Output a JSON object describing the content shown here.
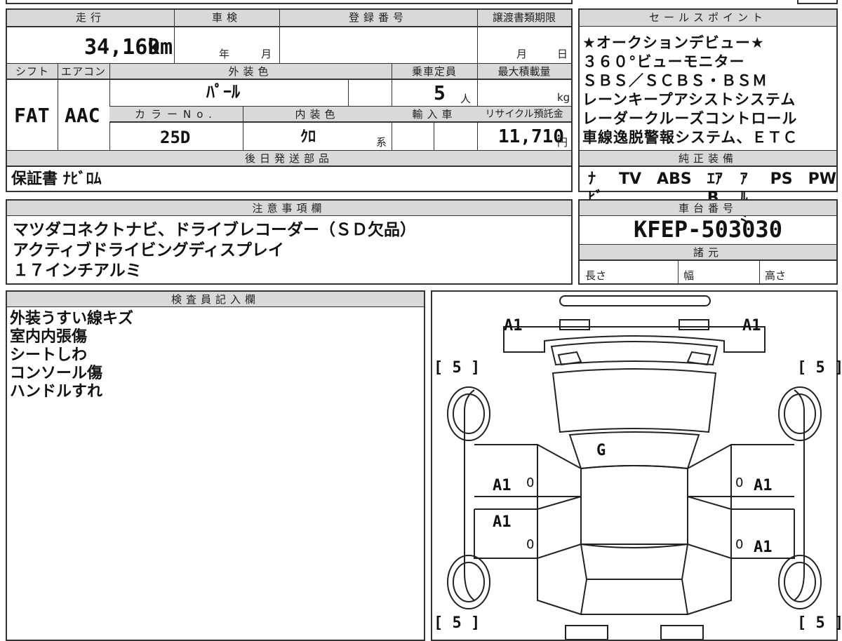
{
  "vehicle": {
    "mileage_label": "走行",
    "mileage_value": "34,169",
    "mileage_unit": "km",
    "inspection_label": "車検",
    "inspection_year_unit": "年",
    "inspection_month_unit": "月",
    "registration_label": "登録番号",
    "transfer_label": "譲渡書類期限",
    "transfer_month_unit": "月",
    "transfer_day_unit": "日",
    "shift_label": "シフト",
    "shift_value": "FAT",
    "aircon_label": "エアコン",
    "aircon_value": "AAC",
    "exterior_label": "外装色",
    "exterior_value": "ﾊﾟｰﾙ",
    "capacity_label": "乗車定員",
    "capacity_value": "5",
    "capacity_unit": "人",
    "max_load_label": "最大積載量",
    "max_load_unit": "kg",
    "color_no_label": "カラーNo.",
    "color_no_value": "25D",
    "interior_label": "内装色",
    "interior_value": "ｸﾛ",
    "interior_unit": "系",
    "import_label": "輸入車",
    "recycle_label": "リサイクル預託金",
    "recycle_value": "11,710",
    "recycle_unit": "円"
  },
  "later_parts": {
    "label": "後日発送部品",
    "value": "保証書 ﾅﾋﾞﾛﾑ"
  },
  "sales_points": {
    "label": "セールスポイント",
    "items": [
      "★オークションデビュー★",
      "３６０°ビューモニター",
      "ＳＢＳ／ＳＣＢＳ・ＢＳＭ",
      "レーンキープアシストシステム",
      "レーダークルーズコントロール",
      "車線逸脱警報システム、ＥＴＣ"
    ]
  },
  "equipment": {
    "label": "純正装備",
    "items": [
      "ﾅﾋﾞ",
      "TV",
      "ABS",
      "ｴｱB",
      "ｱﾙﾐ",
      "PS",
      "PW"
    ]
  },
  "notes": {
    "label": "注意事項欄",
    "lines": [
      "マツダコネクトナビ、ドライブレコーダー（ＳＤ欠品）",
      "アクティブドライビングディスプレイ",
      "１７インチアルミ"
    ]
  },
  "chassis": {
    "label": "車台番号",
    "value": "KFEP-503030"
  },
  "specs": {
    "label": "諸元",
    "length_label": "長さ",
    "width_label": "幅",
    "height_label": "高さ"
  },
  "inspector": {
    "label": "検査員記入欄",
    "lines": [
      "外装うすい線キズ",
      "室内内張傷",
      "シートしわ",
      "コンソール傷",
      "ハンドルすれ"
    ]
  },
  "diagram": {
    "tire_tl": "[ 5 ]",
    "tire_tr": "[ 5 ]",
    "tire_bl": "[ 5 ]",
    "tire_br": "[ 5 ]",
    "front_left": "A1",
    "front_right": "A1",
    "windshield": "G",
    "door_fl": "A1",
    "door_fr": "A1",
    "door_rl": "A1",
    "door_rr": "A1",
    "pillar_fl": "0",
    "pillar_fr": "0",
    "pillar_rl": "0",
    "pillar_rr": "0"
  }
}
